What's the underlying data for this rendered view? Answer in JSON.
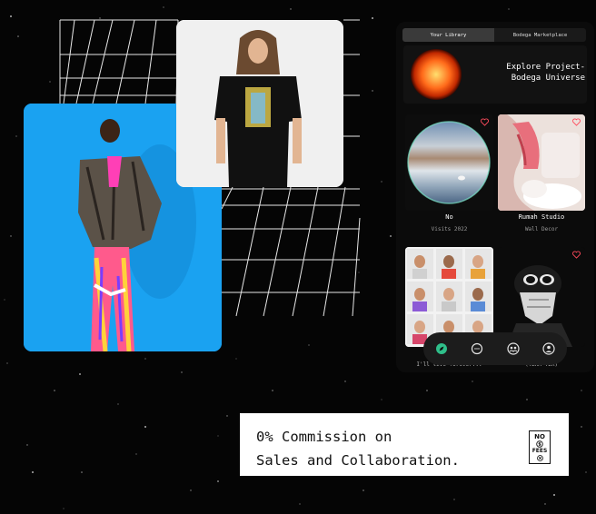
{
  "app": {
    "tabs": [
      {
        "label": "Your Library",
        "active": true
      },
      {
        "label": "Bodega Marketplace",
        "active": false
      }
    ],
    "banner": {
      "text": "Explore Project-Bodega Universe"
    },
    "grid_items": [
      {
        "title": "No",
        "subtitle": "Visits 2022",
        "favorite_icon": "heart-icon"
      },
      {
        "title": "Rumah Studio",
        "subtitle": "Wall Decor",
        "favorite_icon": "heart-icon"
      },
      {
        "title": "",
        "subtitle": "I'll live forever...",
        "favorite_icon": ""
      },
      {
        "title": "",
        "subtitle": "(TEAM TEX)",
        "favorite_icon": "heart-icon"
      }
    ],
    "nav": [
      {
        "icon": "compass-icon",
        "active": true
      },
      {
        "icon": "chat-icon",
        "active": false
      },
      {
        "icon": "community-icon",
        "active": false
      },
      {
        "icon": "profile-icon",
        "active": false
      }
    ],
    "accent_color": "#2fbf8a"
  },
  "promo": {
    "text": "0% Commission on\nSales and Collaboration.",
    "badge_lines": [
      "NO",
      "FEES"
    ]
  }
}
